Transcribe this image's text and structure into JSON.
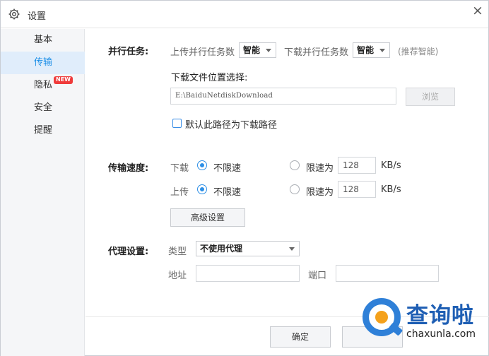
{
  "window": {
    "title": "设置",
    "close_glyph": "×"
  },
  "sidebar": {
    "items": [
      {
        "label": "基本"
      },
      {
        "label": "传输",
        "active": true
      },
      {
        "label": "隐私",
        "badge": "NEW"
      },
      {
        "label": "安全"
      },
      {
        "label": "提醒"
      }
    ]
  },
  "parallel": {
    "section_label": "并行任务:",
    "upload_label": "上传并行任务数",
    "upload_value": "智能",
    "download_label": "下载并行任务数",
    "download_value": "智能",
    "hint": "(推荐智能)"
  },
  "download_location": {
    "label": "下载文件位置选择:",
    "path": "E:\\BaiduNetdiskDownload",
    "browse_label": "浏览",
    "default_checkbox_label": "默认此路径为下载路径",
    "default_checked": false
  },
  "speed": {
    "section_label": "传输速度:",
    "download": {
      "label": "下载",
      "unlimited_label": "不限速",
      "limit_label": "限速为",
      "limit_value": "128",
      "unit": "KB/s",
      "selected": "unlimited"
    },
    "upload": {
      "label": "上传",
      "unlimited_label": "不限速",
      "limit_label": "限速为",
      "limit_value": "128",
      "unit": "KB/s",
      "selected": "unlimited"
    },
    "advanced_button": "高级设置"
  },
  "proxy": {
    "section_label": "代理设置:",
    "type_label": "类型",
    "type_value": "不使用代理",
    "address_label": "地址",
    "address_value": "",
    "port_label": "端口",
    "port_value": ""
  },
  "footer": {
    "ok_label": "确定"
  },
  "watermark": {
    "text_cn": "查询啦",
    "text_en": "chaxunla.com"
  },
  "colors": {
    "accent": "#1c8fe7",
    "active_bg": "#e0edfb",
    "badge": "#ef3b3b"
  }
}
